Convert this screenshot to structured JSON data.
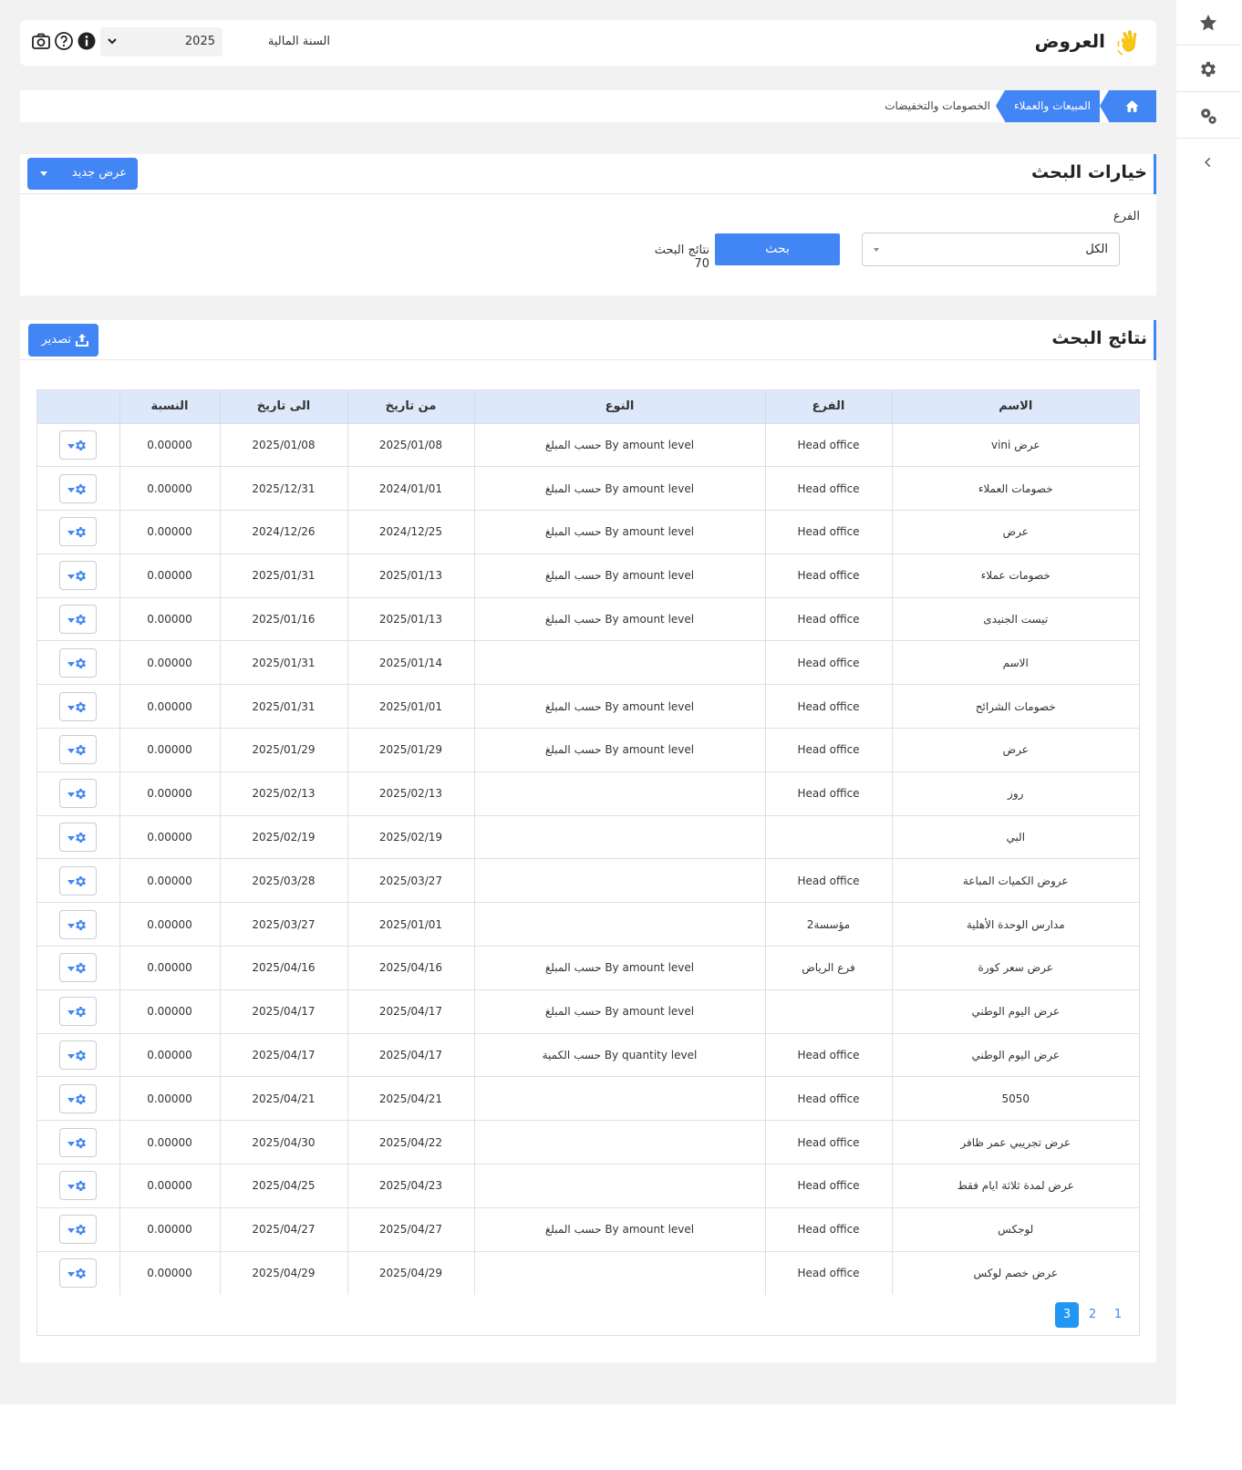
{
  "header": {
    "title": "العروض",
    "fiscal_year_label": "السنة المالية",
    "fiscal_year_value": "2025",
    "icons": [
      "info-icon",
      "help-icon",
      "camera-icon"
    ]
  },
  "sidebar": {
    "items": [
      {
        "icon": "star-icon"
      },
      {
        "icon": "gear-icon"
      },
      {
        "icon": "gears-icon"
      },
      {
        "icon": "chevron-left-icon"
      }
    ]
  },
  "breadcrumb": {
    "home_icon": "home-icon",
    "item1": "المبيعات والعملاء",
    "item2": "الخصومات والتخفيضات"
  },
  "search": {
    "title": "خيارات البحث",
    "new_offer_label": "عرض جديد",
    "branch_label": "الفرع",
    "branch_value": "الكل",
    "search_button": "بحث",
    "results_label": "نتائج البحث",
    "results_count": "70"
  },
  "results": {
    "title": "نتائج البحث",
    "export_label": "تصدير",
    "columns": [
      "الاسم",
      "الفرع",
      "النوع",
      "من تاريخ",
      "الى تاريخ",
      "النسبة",
      ""
    ],
    "rows": [
      {
        "name": "عرض vini",
        "branch": "Head office",
        "type": "حسب المبلغ By amount level",
        "from": "2025/01/08",
        "to": "2025/01/08",
        "pct": "0.00000"
      },
      {
        "name": "خصومات العملاء",
        "branch": "Head office",
        "type": "حسب المبلغ By amount level",
        "from": "2024/01/01",
        "to": "2025/12/31",
        "pct": "0.00000"
      },
      {
        "name": "عرض",
        "branch": "Head office",
        "type": "حسب المبلغ By amount level",
        "from": "2024/12/25",
        "to": "2024/12/26",
        "pct": "0.00000"
      },
      {
        "name": "خصومات عملاء",
        "branch": "Head office",
        "type": "حسب المبلغ By amount level",
        "from": "2025/01/13",
        "to": "2025/01/31",
        "pct": "0.00000"
      },
      {
        "name": "تيست الجنيدى",
        "branch": "Head office",
        "type": "حسب المبلغ By amount level",
        "from": "2025/01/13",
        "to": "2025/01/16",
        "pct": "0.00000"
      },
      {
        "name": "الاسم",
        "branch": "Head office",
        "type": "",
        "from": "2025/01/14",
        "to": "2025/01/31",
        "pct": "0.00000"
      },
      {
        "name": "خصومات الشرائح",
        "branch": "Head office",
        "type": "حسب المبلغ By amount level",
        "from": "2025/01/01",
        "to": "2025/01/31",
        "pct": "0.00000"
      },
      {
        "name": "عرض",
        "branch": "Head office",
        "type": "حسب المبلغ By amount level",
        "from": "2025/01/29",
        "to": "2025/01/29",
        "pct": "0.00000"
      },
      {
        "name": "روز",
        "branch": "Head office",
        "type": "",
        "from": "2025/02/13",
        "to": "2025/02/13",
        "pct": "0.00000"
      },
      {
        "name": "البي",
        "branch": "",
        "type": "",
        "from": "2025/02/19",
        "to": "2025/02/19",
        "pct": "0.00000"
      },
      {
        "name": "عروض الكميات المباعة",
        "branch": "Head office",
        "type": "",
        "from": "2025/03/27",
        "to": "2025/03/28",
        "pct": "0.00000"
      },
      {
        "name": "مدارس الوحدة الأهلية",
        "branch": "مؤسسة2",
        "type": "",
        "from": "2025/01/01",
        "to": "2025/03/27",
        "pct": "0.00000"
      },
      {
        "name": "عرض سعر كورة",
        "branch": "فرع الرياض",
        "type": "حسب المبلغ By amount level",
        "from": "2025/04/16",
        "to": "2025/04/16",
        "pct": "0.00000"
      },
      {
        "name": "عرض اليوم الوطني",
        "branch": "",
        "type": "حسب المبلغ By amount level",
        "from": "2025/04/17",
        "to": "2025/04/17",
        "pct": "0.00000"
      },
      {
        "name": "عرض اليوم الوطني",
        "branch": "Head office",
        "type": "حسب الكمية By quantity level",
        "from": "2025/04/17",
        "to": "2025/04/17",
        "pct": "0.00000"
      },
      {
        "name": "5050",
        "branch": "Head office",
        "type": "",
        "from": "2025/04/21",
        "to": "2025/04/21",
        "pct": "0.00000"
      },
      {
        "name": "عرض تجريبي عمر ظافر",
        "branch": "Head office",
        "type": "",
        "from": "2025/04/22",
        "to": "2025/04/30",
        "pct": "0.00000"
      },
      {
        "name": "عرض لمدة ثلاثة ايام فقط",
        "branch": "Head office",
        "type": "",
        "from": "2025/04/23",
        "to": "2025/04/25",
        "pct": "0.00000"
      },
      {
        "name": "لوجكس",
        "branch": "Head office",
        "type": "حسب المبلغ By amount level",
        "from": "2025/04/27",
        "to": "2025/04/27",
        "pct": "0.00000"
      },
      {
        "name": "عرض خصم لوكس",
        "branch": "Head office",
        "type": "",
        "from": "2025/04/29",
        "to": "2025/04/29",
        "pct": "0.00000"
      }
    ],
    "pages": [
      "1",
      "2",
      "3"
    ],
    "active_page": "3"
  },
  "colors": {
    "accent": "#4285f4",
    "header_row": "#dde8fb",
    "page_bg": "#f2f2f3",
    "active_page": "#2196f3"
  }
}
